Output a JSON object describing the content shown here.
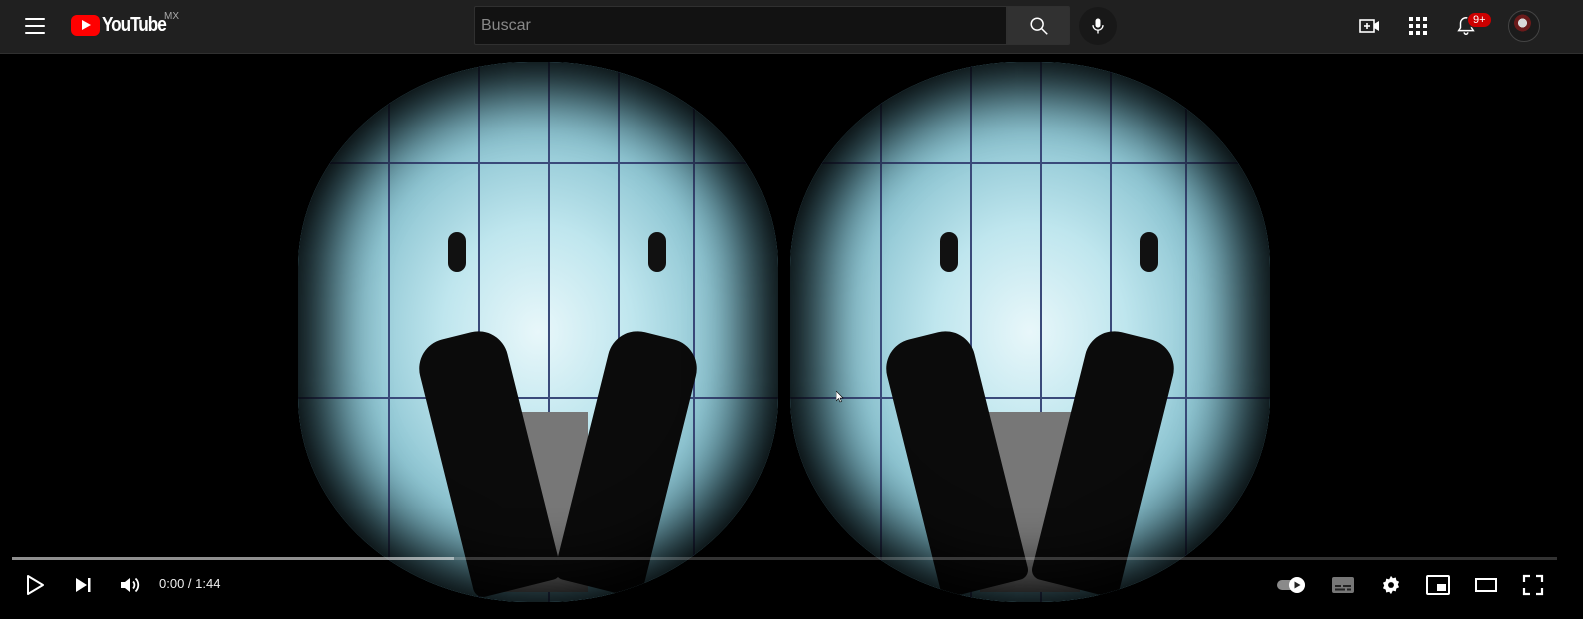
{
  "header": {
    "logo_text": "YouTube",
    "country_code": "MX",
    "search_placeholder": "Buscar",
    "notification_count": "9+"
  },
  "icons": {
    "menu": "menu-icon",
    "search": "search-icon",
    "mic": "mic-icon",
    "create": "create-video-icon",
    "apps": "apps-grid-icon",
    "notifications": "bell-icon",
    "play": "play-icon",
    "next": "next-icon",
    "volume": "volume-icon",
    "autoplay": "autoplay-toggle-icon",
    "subtitles": "subtitles-icon",
    "settings": "settings-gear-icon",
    "miniplayer": "miniplayer-icon",
    "theater": "theater-mode-icon",
    "fullscreen": "fullscreen-icon"
  },
  "player": {
    "time_display": "0:00 / 1:44",
    "progress_played": 0.0,
    "progress_loaded": 0.286
  },
  "colors": {
    "accent": "#ff0000",
    "topbar": "#202020",
    "badge": "#cc0000"
  }
}
